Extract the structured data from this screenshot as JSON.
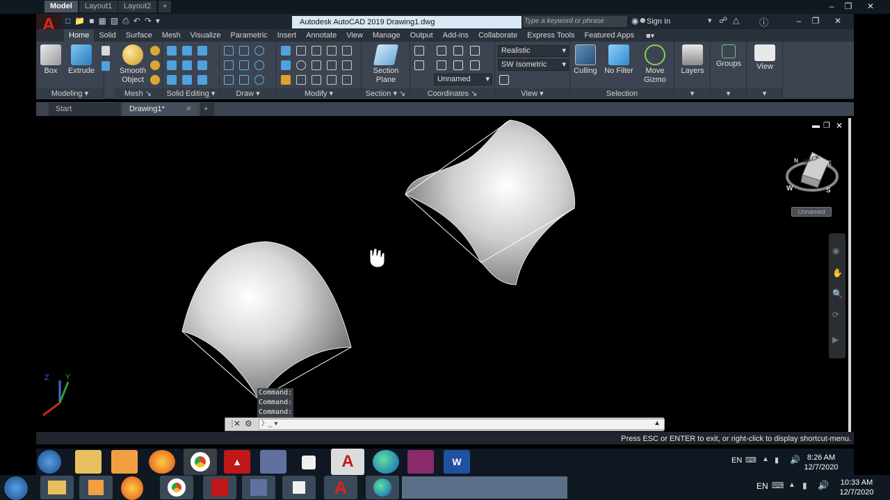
{
  "window": {
    "title": "Autodesk AutoCAD 2019    Drawing1.dwg",
    "search_placeholder": "Type a keyword or phrase",
    "sign_in": "Sign In",
    "logo_letter": "A"
  },
  "ribbon_tabs": [
    "Home",
    "Solid",
    "Surface",
    "Mesh",
    "Visualize",
    "Parametric",
    "Insert",
    "Annotate",
    "View",
    "Manage",
    "Output",
    "Add-ins",
    "Collaborate",
    "Express Tools",
    "Featured Apps"
  ],
  "ribbon": {
    "modeling": {
      "title": "Modeling",
      "box": "Box",
      "extrude": "Extrude"
    },
    "mesh": {
      "title": "Mesh",
      "smooth_object_1": "Smooth",
      "smooth_object_2": "Object"
    },
    "solid_editing": {
      "title": "Solid Editing"
    },
    "draw": {
      "title": "Draw"
    },
    "modify": {
      "title": "Modify"
    },
    "section": {
      "title": "Section",
      "plane_1": "Section",
      "plane_2": "Plane"
    },
    "coordinates": {
      "title": "Coordinates",
      "ucs": "Unnamed"
    },
    "view": {
      "title": "View",
      "visual_style": "Realistic",
      "view_dir": "SW Isometric"
    },
    "selection": {
      "title": "Selection",
      "culling": "Culling",
      "no_filter": "No Filter",
      "move_gizmo_1": "Move",
      "move_gizmo_2": "Gizmo"
    },
    "layers": "Layers",
    "groups": "Groups",
    "view_big": "View"
  },
  "file_tabs": {
    "start": "Start",
    "drawing": "Drawing1*"
  },
  "viewport": {
    "viewcube_face": "BACK",
    "viewcube_compass": {
      "w": "W",
      "s": "S",
      "e": "E",
      "n": "N"
    },
    "ucs_label": "Unnamed",
    "axis": {
      "z": "Z",
      "y": "Y"
    }
  },
  "command": {
    "history": [
      "Command:",
      "Command:",
      "Command:"
    ]
  },
  "layout_tabs": [
    "Model",
    "Layout1",
    "Layout2"
  ],
  "status_message": "Press ESC or ENTER to exit, or right-click to display shortcut-menu.",
  "taskbar1": {
    "lang": "EN",
    "time": "8:26 AM",
    "date": "12/7/2020"
  },
  "taskbar2": {
    "lang": "EN",
    "time": "10:33 AM",
    "date": "12/7/2020"
  },
  "colors": {
    "accent": "#3b4450",
    "autocad_red": "#e02020",
    "viewport": "#000000"
  }
}
